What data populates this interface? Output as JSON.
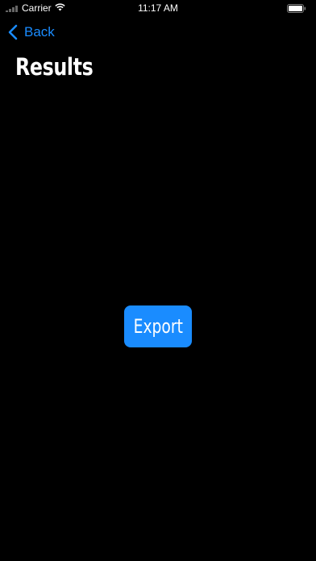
{
  "status_bar": {
    "carrier": "Carrier",
    "time": "11:17 AM"
  },
  "nav": {
    "back_label": "Back"
  },
  "page": {
    "title": "Results"
  },
  "actions": {
    "export_label": "Export"
  },
  "colors": {
    "background": "#000000",
    "accent": "#1a8cff",
    "text": "#ffffff"
  }
}
